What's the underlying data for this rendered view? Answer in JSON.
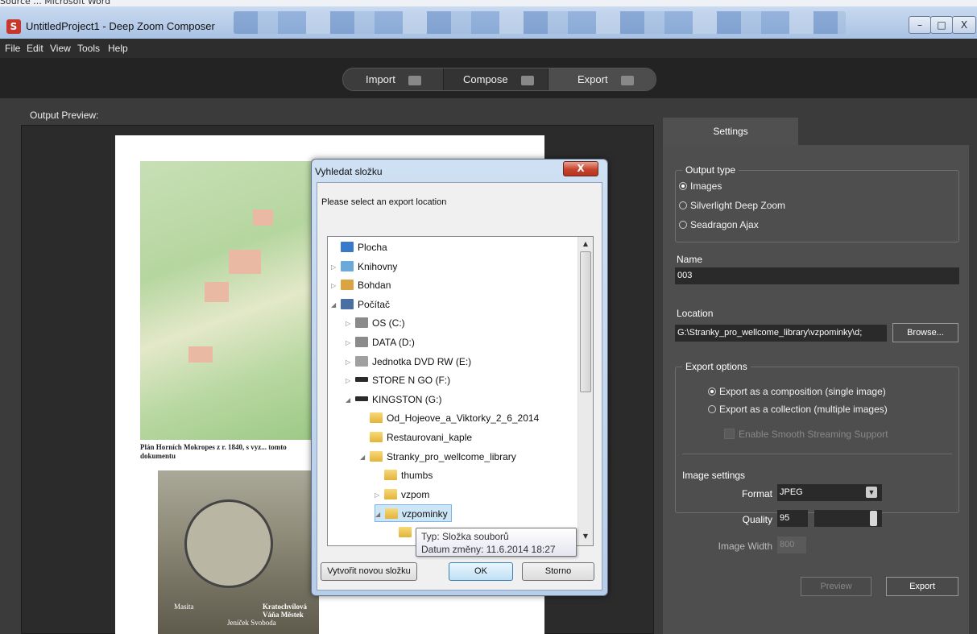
{
  "background_window_title": "Source ... Microsoft Word",
  "window": {
    "title": "UntitledProject1 - Deep Zoom Composer",
    "minimize": "–",
    "maximize": "□",
    "close": "X"
  },
  "menu": [
    "File",
    "Edit",
    "View",
    "Tools",
    "Help"
  ],
  "modes": {
    "import": "Import",
    "compose": "Compose",
    "export": "Export"
  },
  "preview": {
    "label": "Output Preview:",
    "caption": "Plán Horních Mokropes z r. 1840, s vyz... tomto dokumentu",
    "photo_labels": [
      "Masita",
      "Jeníček   Svoboda",
      "Kratochvílová   Váňa   Městek"
    ]
  },
  "settings": {
    "tab": "Settings",
    "output_type": {
      "title": "Output type",
      "options": [
        "Images",
        "Silverlight Deep Zoom",
        "Seadragon Ajax"
      ],
      "selected": 0
    },
    "name_label": "Name",
    "name_value": "003",
    "location_label": "Location",
    "location_value": "G:\\Stranky_pro_wellcome_library\\vzpominky\\d;",
    "browse": "Browse...",
    "export_options": {
      "title": "Export options",
      "composition": "Export as a composition (single image)",
      "collection": "Export as a collection (multiple images)",
      "smooth": "Enable Smooth Streaming Support"
    },
    "image_settings": {
      "title": "Image settings",
      "format_label": "Format",
      "format_value": "JPEG",
      "quality_label": "Quality",
      "quality_value": "95",
      "quality_level": 0.95,
      "width_label": "Image Width",
      "width_value": "800"
    },
    "preview_button": "Preview",
    "export_button": "Export"
  },
  "dialog": {
    "title": "Vyhledat složku",
    "close": "X",
    "prompt": "Please select an export location",
    "tree": [
      {
        "label": "Plocha",
        "icon": "desktop-icon",
        "level": 0,
        "arrow": ""
      },
      {
        "label": "Knihovny",
        "icon": "libraries-icon",
        "level": 0,
        "arrow": "▷"
      },
      {
        "label": "Bohdan",
        "icon": "user-folder-icon",
        "level": 0,
        "arrow": "▷"
      },
      {
        "label": "Počítač",
        "icon": "computer-icon",
        "level": 0,
        "arrow": "◢"
      },
      {
        "label": "OS (C:)",
        "icon": "drive-icon",
        "level": 1,
        "arrow": "▷"
      },
      {
        "label": "DATA (D:)",
        "icon": "drive-icon",
        "level": 1,
        "arrow": "▷"
      },
      {
        "label": "Jednotka DVD RW (E:)",
        "icon": "dvd-icon",
        "level": 1,
        "arrow": "▷"
      },
      {
        "label": "STORE N GO (F:)",
        "icon": "usb-icon",
        "level": 1,
        "arrow": "▷"
      },
      {
        "label": "KINGSTON (G:)",
        "icon": "usb-icon",
        "level": 1,
        "arrow": "◢"
      },
      {
        "label": "Od_Hojeove_a_Viktorky_2_6_2014",
        "icon": "folder-icon",
        "level": 2,
        "arrow": ""
      },
      {
        "label": "Restaurovani_kaple",
        "icon": "folder-icon",
        "level": 2,
        "arrow": ""
      },
      {
        "label": "Stranky_pro_wellcome_library",
        "icon": "folder-icon",
        "level": 2,
        "arrow": "◢"
      },
      {
        "label": "thumbs",
        "icon": "folder-icon",
        "level": 3,
        "arrow": ""
      },
      {
        "label": "vzpom",
        "icon": "folder-icon",
        "level": 3,
        "arrow": "▷"
      },
      {
        "label": "vzpominky",
        "icon": "folder-icon",
        "level": 3,
        "arrow": "◢"
      },
      {
        "label": "css",
        "icon": "folder-icon",
        "level": 4,
        "arrow": ""
      }
    ],
    "tooltip_type": "Typ: Složka souborů",
    "tooltip_date": "Datum změny: 11.6.2014 18:27",
    "new_folder": "Vytvořit novou složku",
    "ok": "OK",
    "cancel": "Storno"
  }
}
